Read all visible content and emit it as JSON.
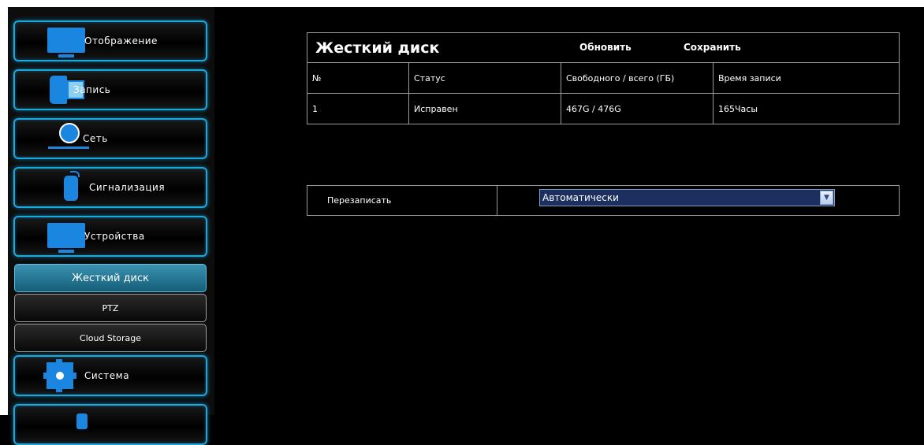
{
  "sidebar": {
    "items": [
      {
        "label": "Отображение",
        "icon": "monitor-icon"
      },
      {
        "label": "Запись",
        "icon": "record-icon"
      },
      {
        "label": "Сеть",
        "icon": "network-icon"
      },
      {
        "label": "Сигнализация",
        "icon": "alarm-icon"
      },
      {
        "label": "Устройства",
        "icon": "devices-icon"
      }
    ],
    "submenu": [
      {
        "label": "Жесткий диск",
        "active": true
      },
      {
        "label": "PTZ",
        "active": false
      },
      {
        "label": "Cloud Storage",
        "active": false
      }
    ],
    "system": {
      "label": "Система",
      "icon": "gear-icon"
    }
  },
  "hdd": {
    "title": "Жесткий диск",
    "refresh_label": "Обновить",
    "save_label": "Сохранить",
    "columns": [
      "№",
      "Статус",
      "Свободного / всего (ГБ)",
      "Время записи"
    ],
    "rows": [
      [
        "1",
        "Исправен",
        "467G / 476G",
        "165Часы"
      ]
    ]
  },
  "overwrite": {
    "label": "Перезаписать",
    "value": "Автоматически"
  },
  "colors": {
    "accent": "#1aa9dd",
    "icon_blue": "#1a86e0",
    "active_sub": "#2a7f9e",
    "select_bg": "#1c2f5e"
  }
}
